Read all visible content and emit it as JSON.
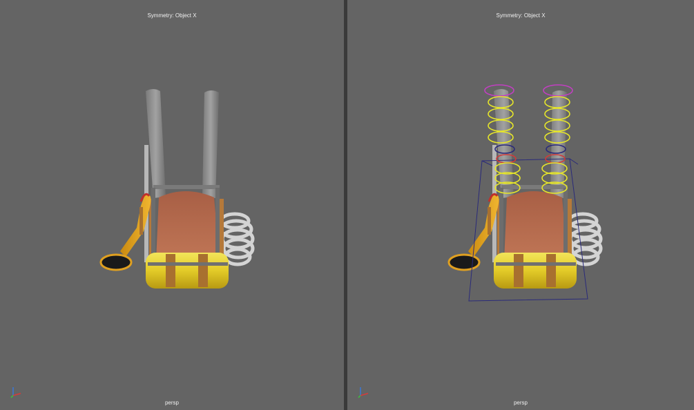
{
  "viewports": [
    {
      "symmetry_label": "Symmetry: Object X",
      "camera_label": "persp",
      "show_manipulators": false
    },
    {
      "symmetry_label": "Symmetry: Object X",
      "camera_label": "persp",
      "show_manipulators": true
    }
  ],
  "colors": {
    "viewport_bg": "#646464",
    "pillar": "#8a8a8a",
    "seat": "#b56a4e",
    "roll_yellow": "#e8d33a",
    "strap": "#b5793a",
    "trumpet": "#e0a020",
    "rope": "#cfcfcf",
    "control_yellow": "#e6e62a",
    "control_magenta": "#c23fc2",
    "bounding_box": "#2a2a7a"
  }
}
